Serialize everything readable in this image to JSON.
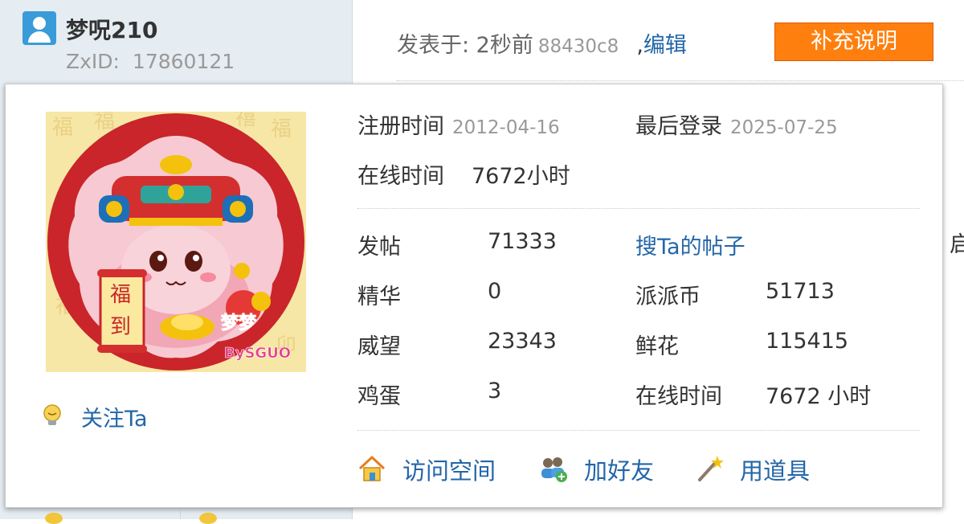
{
  "author": {
    "name": "梦呪210",
    "zxid_label": "ZxID:",
    "zxid_value": "17860121",
    "icon": "user-icon"
  },
  "post": {
    "meta_prefix": "发表于: 2秒前",
    "hash": "88430c8",
    "separator": ",",
    "edit_link": "编辑",
    "supplement_button": "补充说明"
  },
  "edge_text": "启",
  "profile": {
    "follow_label": "关注Ta",
    "register_label": "注册时间",
    "register_date": "2012-04-16",
    "last_login_label": "最后登录",
    "last_login_date": "2025-07-25",
    "online_time_label": "在线时间",
    "online_time_value": "7672小时",
    "stats": [
      {
        "label": "发帖",
        "value": "71333"
      },
      {
        "label": "精华",
        "value": "0"
      },
      {
        "label": "威望",
        "value": "23343"
      },
      {
        "label": "鸡蛋",
        "value": "3"
      }
    ],
    "search_posts_link": "搜Ta的帖子",
    "stats_right": [
      {
        "label": "派派币",
        "value": "51713"
      },
      {
        "label": "鲜花",
        "value": "115415"
      },
      {
        "label": "在线时间",
        "value": "7672 小时"
      }
    ],
    "actions": [
      {
        "label": "访问空间",
        "icon": "home-icon"
      },
      {
        "label": "加好友",
        "icon": "add-friend-icon"
      },
      {
        "label": "用道具",
        "icon": "magic-wand-icon"
      }
    ]
  },
  "avatar_image": {
    "text_top": "福",
    "text_bottom": "到",
    "brand": "梦梦",
    "byline": "BySGUO"
  },
  "colors": {
    "link": "#2366a8",
    "button": "#ff7f0e",
    "sidebar": "#e5edf2",
    "avatar_red": "#c62828"
  }
}
